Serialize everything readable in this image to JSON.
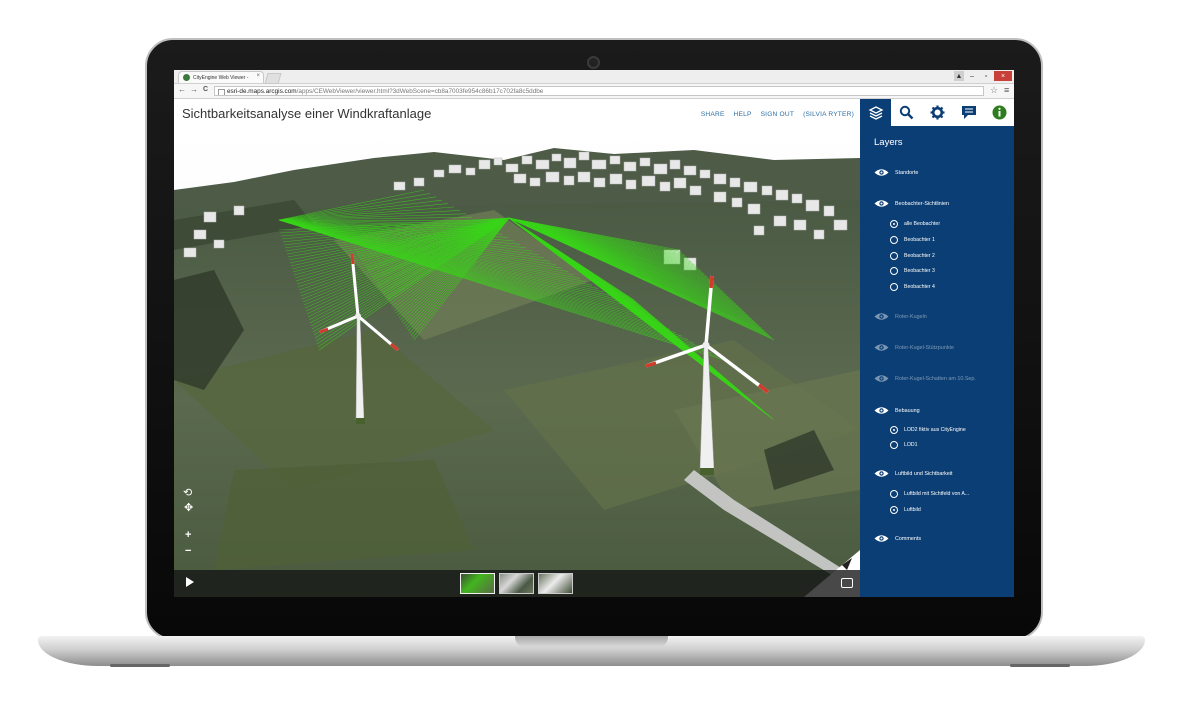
{
  "browser": {
    "tab_title": "CityEngine Web Viewer - ",
    "tab_close": "×",
    "url_domain": "esri-de.maps.arcgis.com",
    "url_path": "/apps/CEWebViewer/viewer.html?3dWebScene=cb8a7003fe954c86b17c702fa8c5ddbe",
    "back": "←",
    "forward": "→",
    "reload": "C",
    "bookmark_star": "☆",
    "menu": "≡",
    "minimize": "–",
    "restore": "▫",
    "close": "×"
  },
  "app": {
    "title": "Sichtbarkeitsanalyse einer Windkraftanlage",
    "header_links": [
      "SHARE",
      "HELP",
      "SIGN OUT",
      "(SILVIA RYTER)"
    ]
  },
  "toolbar": {
    "icons": [
      "layers-icon",
      "search-icon",
      "gear-icon",
      "comment-icon",
      "info-icon"
    ],
    "active": "layers-icon",
    "accent": "#0b3e74"
  },
  "panel": {
    "title": "Layers",
    "layers": [
      {
        "label": "Standorte",
        "enabled": true,
        "options": []
      },
      {
        "label": "Beobachter-Sichtlinien",
        "enabled": true,
        "options": [
          {
            "label": "alle Beobachter",
            "selected": true
          },
          {
            "label": "Beobachter 1",
            "selected": false
          },
          {
            "label": "Beobachter 2",
            "selected": false
          },
          {
            "label": "Beobachter 3",
            "selected": false
          },
          {
            "label": "Beobachter 4",
            "selected": false
          }
        ]
      },
      {
        "label": "Roter-Kugeln",
        "enabled": false,
        "options": []
      },
      {
        "label": "Roter-Kugel-Stützpunkte",
        "enabled": false,
        "options": []
      },
      {
        "label": "Roter-Kugel-Schatten am 10.Sep.",
        "enabled": false,
        "options": []
      },
      {
        "label": "Bebauung",
        "enabled": true,
        "options": [
          {
            "label": "LOD2 fiktiv aus CityEngine",
            "selected": true
          },
          {
            "label": "LOD1",
            "selected": false
          }
        ]
      },
      {
        "label": "Luftbild und Sichtbarkeit",
        "enabled": true,
        "options": [
          {
            "label": "Luftbild mit Sichtfeld von A...",
            "selected": false
          },
          {
            "label": "Luftbild",
            "selected": true
          }
        ]
      },
      {
        "label": "Comments",
        "enabled": true,
        "options": []
      }
    ]
  },
  "scene": {
    "sightline_color": "#39d61a",
    "thumbnails": [
      "thumbnail-1",
      "thumbnail-2",
      "thumbnail-3"
    ],
    "active_thumbnail": 0,
    "nav_controls": {
      "rotate": "⟲",
      "pan": "✥",
      "zoom_in": "+",
      "zoom_out": "−"
    }
  }
}
